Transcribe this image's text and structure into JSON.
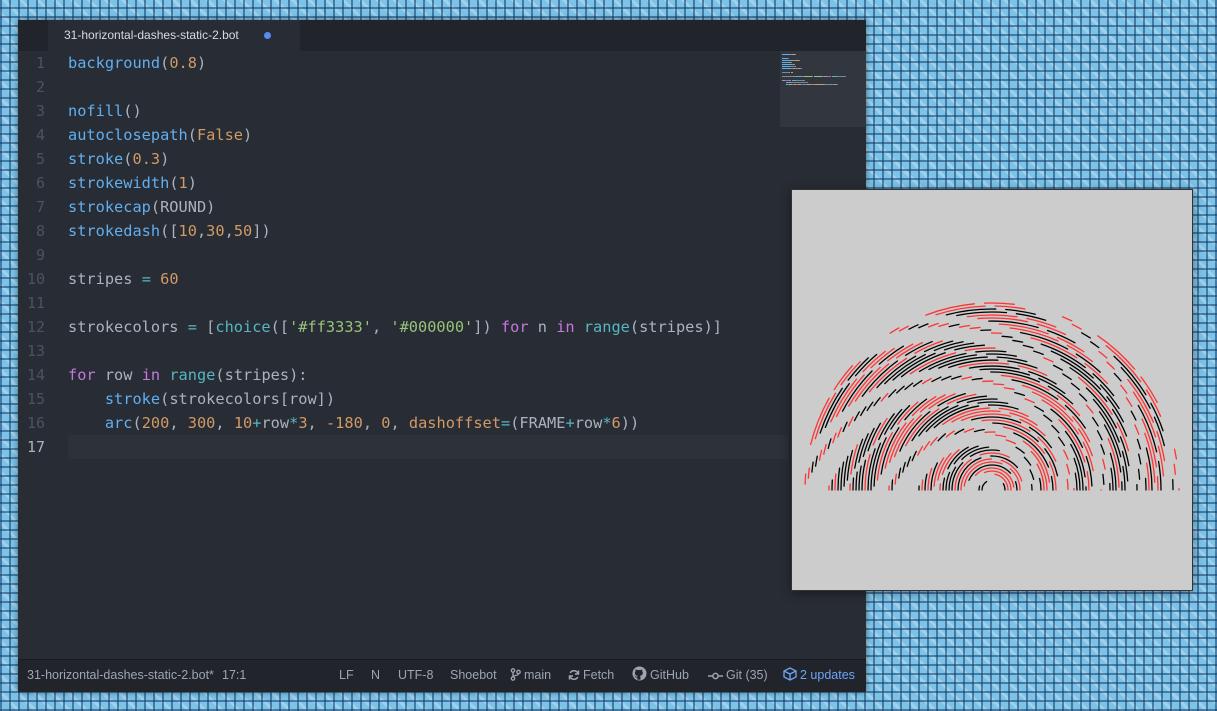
{
  "tab": {
    "title": "31-horizontal-dashes-static-2.bot"
  },
  "line_numbers": [
    "1",
    "2",
    "3",
    "4",
    "5",
    "6",
    "7",
    "8",
    "9",
    "10",
    "11",
    "12",
    "13",
    "14",
    "15",
    "16",
    "17"
  ],
  "active_line": 17,
  "code_lines": [
    [
      {
        "t": "background",
        "c": "fn"
      },
      {
        "t": "(",
        "c": "punct"
      },
      {
        "t": "0.8",
        "c": "num"
      },
      {
        "t": ")",
        "c": "punct"
      }
    ],
    [],
    [
      {
        "t": "nofill",
        "c": "fn"
      },
      {
        "t": "()",
        "c": "punct"
      }
    ],
    [
      {
        "t": "autoclosepath",
        "c": "fn"
      },
      {
        "t": "(",
        "c": "punct"
      },
      {
        "t": "False",
        "c": "num"
      },
      {
        "t": ")",
        "c": "punct"
      }
    ],
    [
      {
        "t": "stroke",
        "c": "fn"
      },
      {
        "t": "(",
        "c": "punct"
      },
      {
        "t": "0.3",
        "c": "num"
      },
      {
        "t": ")",
        "c": "punct"
      }
    ],
    [
      {
        "t": "strokewidth",
        "c": "fn"
      },
      {
        "t": "(",
        "c": "punct"
      },
      {
        "t": "1",
        "c": "num"
      },
      {
        "t": ")",
        "c": "punct"
      }
    ],
    [
      {
        "t": "strokecap",
        "c": "fn"
      },
      {
        "t": "(ROUND)",
        "c": "punct"
      }
    ],
    [
      {
        "t": "strokedash",
        "c": "fn"
      },
      {
        "t": "([",
        "c": "punct"
      },
      {
        "t": "10",
        "c": "num"
      },
      {
        "t": ",",
        "c": "punct"
      },
      {
        "t": "30",
        "c": "num"
      },
      {
        "t": ",",
        "c": "punct"
      },
      {
        "t": "50",
        "c": "num"
      },
      {
        "t": "])",
        "c": "punct"
      }
    ],
    [],
    [
      {
        "t": "stripes ",
        "c": "punct"
      },
      {
        "t": "=",
        "c": "op"
      },
      {
        "t": " ",
        "c": "punct"
      },
      {
        "t": "60",
        "c": "num"
      }
    ],
    [],
    [
      {
        "t": "strokecolors ",
        "c": "punct"
      },
      {
        "t": "=",
        "c": "op"
      },
      {
        "t": " [",
        "c": "punct"
      },
      {
        "t": "choice",
        "c": "bi"
      },
      {
        "t": "([",
        "c": "punct"
      },
      {
        "t": "'#ff3333'",
        "c": "str"
      },
      {
        "t": ", ",
        "c": "punct"
      },
      {
        "t": "'#000000'",
        "c": "str"
      },
      {
        "t": "]) ",
        "c": "punct"
      },
      {
        "t": "for",
        "c": "kw"
      },
      {
        "t": " n ",
        "c": "punct"
      },
      {
        "t": "in",
        "c": "kw"
      },
      {
        "t": " ",
        "c": "punct"
      },
      {
        "t": "range",
        "c": "bi"
      },
      {
        "t": "(stripes)]",
        "c": "punct"
      }
    ],
    [],
    [
      {
        "t": "for",
        "c": "kw"
      },
      {
        "t": " row ",
        "c": "punct"
      },
      {
        "t": "in",
        "c": "kw"
      },
      {
        "t": " ",
        "c": "punct"
      },
      {
        "t": "range",
        "c": "bi"
      },
      {
        "t": "(stripes):",
        "c": "punct"
      }
    ],
    [
      {
        "t": "    ",
        "c": "punct"
      },
      {
        "t": "stroke",
        "c": "fn"
      },
      {
        "t": "(strokecolors[row])",
        "c": "punct"
      }
    ],
    [
      {
        "t": "    ",
        "c": "punct"
      },
      {
        "t": "arc",
        "c": "fn"
      },
      {
        "t": "(",
        "c": "punct"
      },
      {
        "t": "200",
        "c": "num"
      },
      {
        "t": ", ",
        "c": "punct"
      },
      {
        "t": "300",
        "c": "num"
      },
      {
        "t": ", ",
        "c": "punct"
      },
      {
        "t": "10",
        "c": "num"
      },
      {
        "t": "+",
        "c": "op"
      },
      {
        "t": "row",
        "c": "punct"
      },
      {
        "t": "*",
        "c": "op"
      },
      {
        "t": "3",
        "c": "num"
      },
      {
        "t": ", ",
        "c": "punct"
      },
      {
        "t": "-180",
        "c": "num"
      },
      {
        "t": ", ",
        "c": "punct"
      },
      {
        "t": "0",
        "c": "num"
      },
      {
        "t": ", ",
        "c": "punct"
      },
      {
        "t": "dashoffset",
        "c": "kwarg"
      },
      {
        "t": "=",
        "c": "op"
      },
      {
        "t": "(FRAME",
        "c": "punct"
      },
      {
        "t": "+",
        "c": "op"
      },
      {
        "t": "row",
        "c": "punct"
      },
      {
        "t": "*",
        "c": "op"
      },
      {
        "t": "6",
        "c": "num"
      },
      {
        "t": "))",
        "c": "punct"
      }
    ],
    []
  ],
  "status": {
    "filename": "31-horizontal-dashes-static-2.bot*",
    "cursor": "17:1",
    "line_ending": "LF",
    "indent": "N",
    "encoding": "UTF-8",
    "grammar": "Shoebot",
    "branch": "main",
    "fetch": "Fetch",
    "github": "GitHub",
    "git": "Git (35)",
    "updates": "2 updates"
  },
  "colors": {
    "editor_bg": "#282c34",
    "preview_bg": "#cccccc",
    "stroke_red": "#ff3333",
    "stroke_black": "#000000",
    "accent_blue": "#578af2"
  }
}
